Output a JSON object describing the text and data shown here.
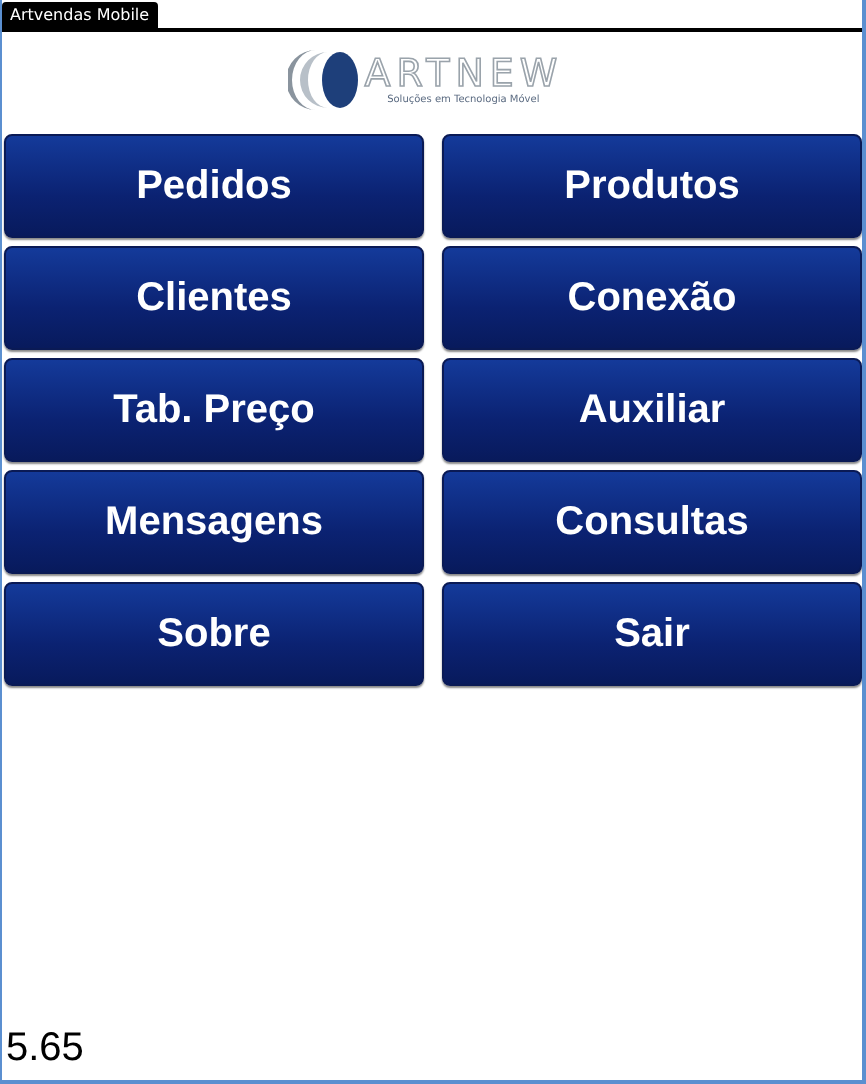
{
  "window": {
    "title": "Artvendas Mobile"
  },
  "logo": {
    "name": "ARTNEW",
    "tagline": "Soluções em Tecnologia Móvel"
  },
  "menu": [
    {
      "label": "Pedidos"
    },
    {
      "label": "Produtos"
    },
    {
      "label": "Clientes"
    },
    {
      "label": "Conexão"
    },
    {
      "label": "Tab. Preço"
    },
    {
      "label": "Auxiliar"
    },
    {
      "label": "Mensagens"
    },
    {
      "label": "Consultas"
    },
    {
      "label": "Sobre"
    },
    {
      "label": "Sair"
    }
  ],
  "version": "5.65"
}
